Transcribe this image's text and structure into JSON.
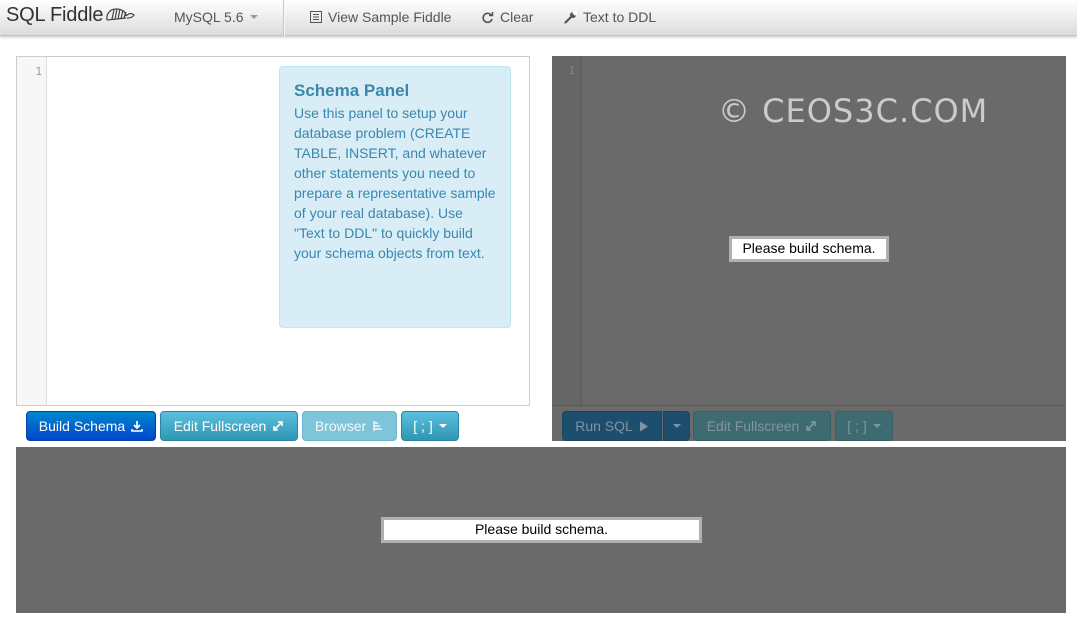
{
  "brand": {
    "name": "SQL Fiddle",
    "logo_icon": "seahorse-logo-icon"
  },
  "nav": {
    "db_version": "MySQL 5.6",
    "view_sample": "View Sample Fiddle",
    "clear": "Clear",
    "text_to_ddl": "Text to DDL"
  },
  "schema_panel": {
    "line_number": "1",
    "help_title": "Schema Panel",
    "help_text": "Use this panel to setup your database problem (CREATE TABLE, INSERT, and whatever other statements you need to prepare a representative sample of your real database). Use \"Text to DDL\" to quickly build your schema objects from text."
  },
  "schema_buttons": {
    "build": "Build Schema",
    "edit_fullscreen": "Edit Fullscreen",
    "browser": "Browser",
    "terminator": "[ ; ]"
  },
  "query_panel": {
    "line_number": "1",
    "watermark": "© CEOS3C.COM",
    "notice": "Please build schema."
  },
  "query_buttons": {
    "run": "Run SQL",
    "edit_fullscreen": "Edit Fullscreen",
    "terminator": "[ ; ]"
  },
  "results_panel": {
    "notice": "Please build schema."
  },
  "colors": {
    "primary": "#0055cc",
    "info": "#49afcd",
    "overlay": "#6a6a6a",
    "help_bg": "#d9edf7",
    "help_text": "#3a87ad"
  }
}
